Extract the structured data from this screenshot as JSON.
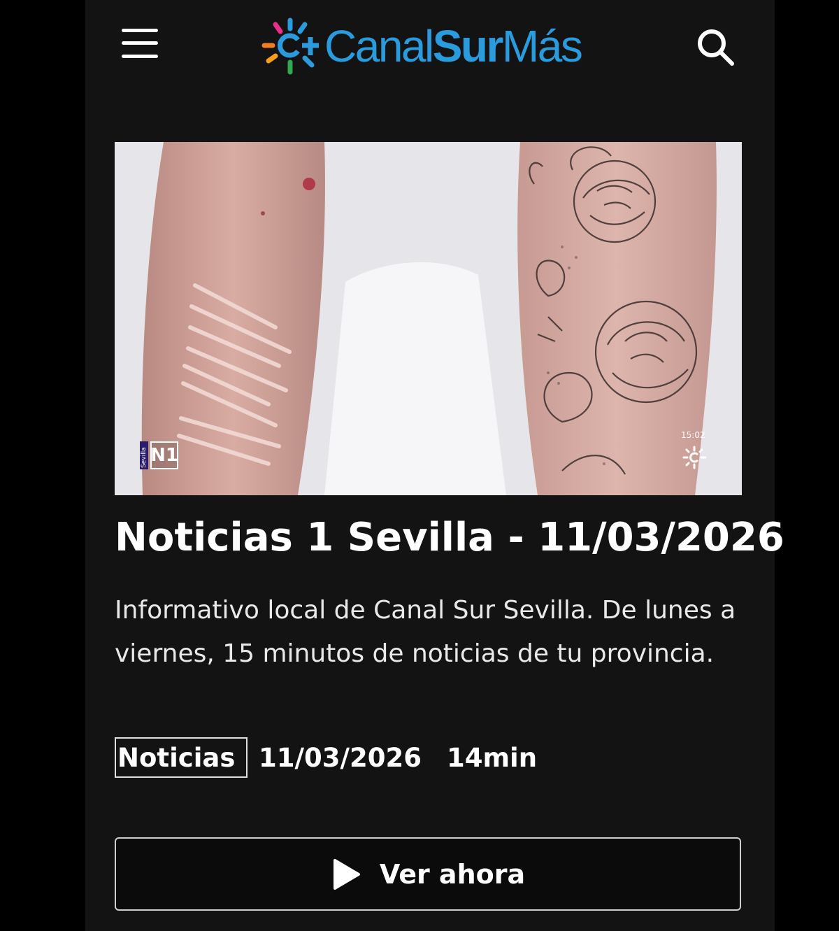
{
  "header": {
    "menu_icon": "hamburger-menu-icon",
    "logo": {
      "text_part1": "Canal",
      "text_part2": "Sur",
      "text_part3": "Más",
      "mark_icon": "canal-sur-sun-icon"
    },
    "search_icon": "search-icon"
  },
  "media": {
    "thumbnail": "forearm-scars-and-floral-tattoo",
    "channel_badge": {
      "region": "Sevilla",
      "label": "N1"
    },
    "clock": "15:02"
  },
  "program": {
    "title": "Noticias 1 Sevilla - 11/03/2026",
    "description": "Informativo local de Canal Sur Sevilla. De lunes a viernes, 15 minutos de noticias de tu provincia.",
    "category": "Noticias",
    "date": "11/03/2026",
    "duration": "14min"
  },
  "actions": {
    "watch_label": "Ver ahora",
    "watch_icon": "play-icon"
  },
  "colors": {
    "background": "#131313",
    "brand_blue": "#2a9bdc",
    "text": "#ffffff"
  }
}
